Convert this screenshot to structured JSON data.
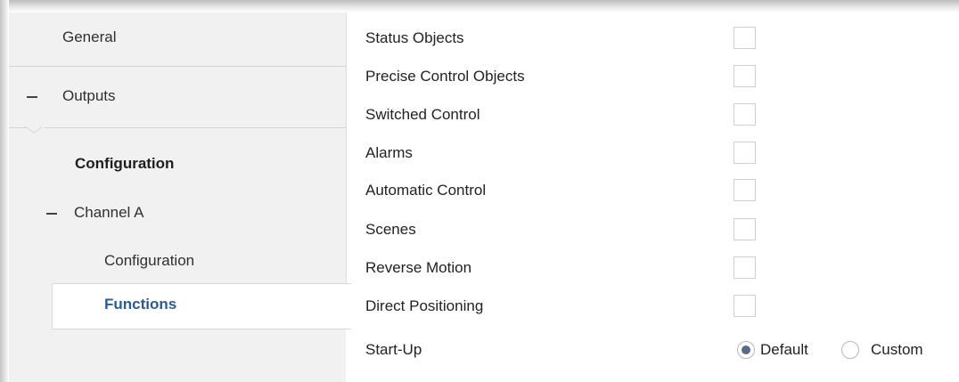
{
  "sidebar": {
    "items": [
      {
        "label": "General"
      },
      {
        "label": "Outputs",
        "expanded": true
      },
      {
        "label": "Configuration"
      },
      {
        "label": "Channel A",
        "expanded": true
      },
      {
        "label": "Configuration"
      },
      {
        "label": "Functions",
        "selected": true
      }
    ]
  },
  "functions": {
    "rows": [
      {
        "label": "Status Objects",
        "checked": false
      },
      {
        "label": "Precise Control Objects",
        "checked": false
      },
      {
        "label": "Switched Control",
        "checked": false
      },
      {
        "label": "Alarms",
        "checked": false
      },
      {
        "label": "Automatic Control",
        "checked": false
      },
      {
        "label": "Scenes",
        "checked": false
      },
      {
        "label": "Reverse Motion",
        "checked": false
      },
      {
        "label": "Direct Positioning",
        "checked": false
      }
    ],
    "startup": {
      "label": "Start-Up",
      "options": [
        "Default",
        "Custom"
      ],
      "selected": "Default"
    }
  },
  "colors": {
    "selected_text": "#2a5a9a",
    "sidebar_bg": "#f1f1f1",
    "radio_fill": "#5a6b85"
  }
}
